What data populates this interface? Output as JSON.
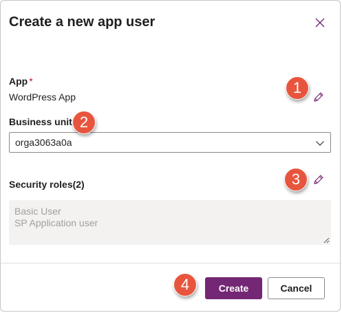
{
  "dialog": {
    "title": "Create a new app user",
    "close_icon": "close-icon"
  },
  "app": {
    "label": "App",
    "required_marker": "*",
    "value": "WordPress App",
    "edit_icon": "pencil-icon"
  },
  "business_unit": {
    "label": "Business unit",
    "required_marker": "*",
    "selected": "orga3063a0a",
    "dropdown_icon": "chevron-down-icon"
  },
  "security_roles": {
    "label": "Security roles(2)",
    "edit_icon": "pencil-icon",
    "roles": [
      "Basic User",
      "SP Application user"
    ]
  },
  "footer": {
    "create_label": "Create",
    "cancel_label": "Cancel"
  },
  "callouts": [
    "1",
    "2",
    "3",
    "4"
  ],
  "colors": {
    "accent": "#742774",
    "required": "#c50f1f",
    "callout": "#e8553e"
  }
}
